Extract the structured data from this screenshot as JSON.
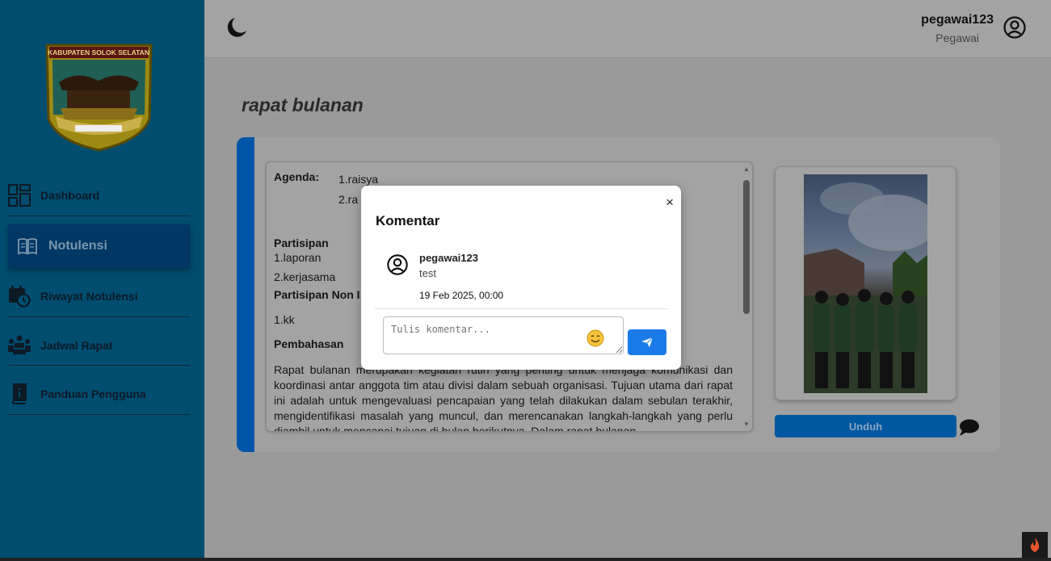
{
  "sidebar": {
    "logo_text": "KABUPATEN SOLOK SELATAN",
    "items": [
      {
        "label": "Dashboard",
        "icon": "dashboard-icon"
      },
      {
        "label": "Notulensi",
        "icon": "book-icon"
      },
      {
        "label": "Riwayat Notulensi",
        "icon": "history-icon"
      },
      {
        "label": "Jadwal Rapat",
        "icon": "people-icon"
      },
      {
        "label": "Panduan Pengguna",
        "icon": "guide-icon"
      }
    ]
  },
  "header": {
    "user_name": "pegawai123",
    "user_role": "Pegawai"
  },
  "main": {
    "title": "rapat bulanan",
    "agenda_label": "Agenda:",
    "agenda_items": [
      "1.raisya",
      "2.ra"
    ],
    "partisipan_label": "Partisipan",
    "partisipan_items": [
      "1.laporan",
      "2.kerjasama"
    ],
    "partisipan_non_label": "Partisipan Non I",
    "partisipan_non_items": [
      "1.kk"
    ],
    "pembahasan_label": "Pembahasan",
    "pembahasan_text": "Rapat bulanan merupakan kegiatan rutin yang penting untuk menjaga komunikasi dan koordinasi antar anggota tim atau divisi dalam sebuah organisasi. Tujuan utama dari rapat ini adalah untuk mengevaluasi pencapaian yang telah dilakukan dalam sebulan terakhir, mengidentifikasi masalah yang muncul, dan merencanakan langkah-langkah yang perlu diambil untuk mencapai tujuan di bulan berikutnya. Dalam rapat bulanan,",
    "download_label": "Unduh"
  },
  "modal": {
    "close_label": "×",
    "title": "Komentar",
    "comments": [
      {
        "user": "pegawai123",
        "text": "test",
        "date": "19 Feb 2025, 00:00"
      }
    ],
    "input_placeholder": "Tulis komentar..."
  },
  "colors": {
    "sidebar_bg": "#004d70",
    "accent": "#0055a8",
    "send_button": "#1a7be8"
  }
}
